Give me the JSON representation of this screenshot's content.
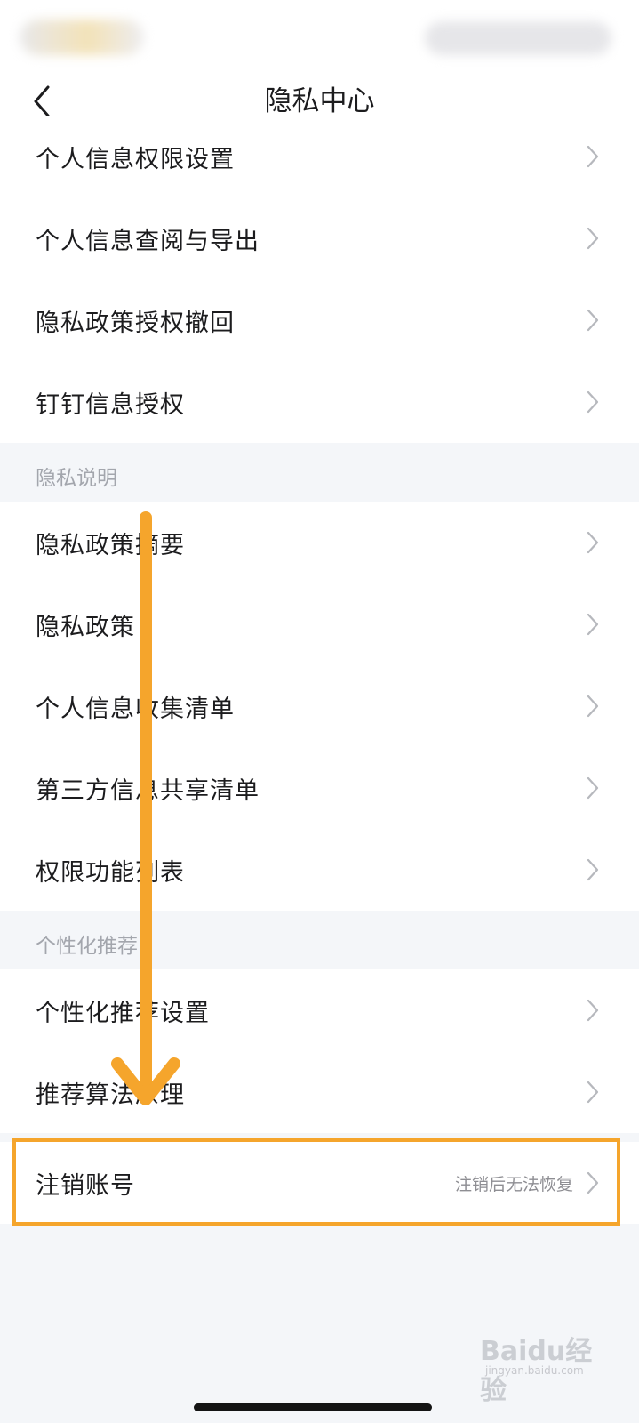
{
  "header": {
    "title": "隐私中心"
  },
  "groups": {
    "settings": {
      "items": [
        {
          "label": "个人信息权限设置"
        },
        {
          "label": "个人信息查阅与导出"
        },
        {
          "label": "隐私政策授权撤回"
        },
        {
          "label": "钉钉信息授权"
        }
      ]
    },
    "privacy_notes": {
      "header": "隐私说明",
      "items": [
        {
          "label": "隐私政策摘要"
        },
        {
          "label": "隐私政策"
        },
        {
          "label": "个人信息收集清单"
        },
        {
          "label": "第三方信息共享清单"
        },
        {
          "label": "权限功能列表"
        }
      ]
    },
    "personalization": {
      "header": "个性化推荐",
      "items": [
        {
          "label": "个性化推荐设置"
        },
        {
          "label": "推荐算法原理"
        }
      ]
    },
    "account": {
      "label": "注销账号",
      "note": "注销后无法恢复"
    }
  },
  "annotation": {
    "color": "#f5a52c"
  },
  "watermark": {
    "brand": "Baidu经验",
    "sub": "jingyan.baidu.com"
  },
  "colors": {
    "background": "#f4f6f9",
    "card": "#ffffff",
    "section_text": "#a3a6ad",
    "chevron": "#b6b8bd"
  },
  "icons": {
    "back": "chevron-left-icon",
    "row": "chevron-right-icon"
  }
}
